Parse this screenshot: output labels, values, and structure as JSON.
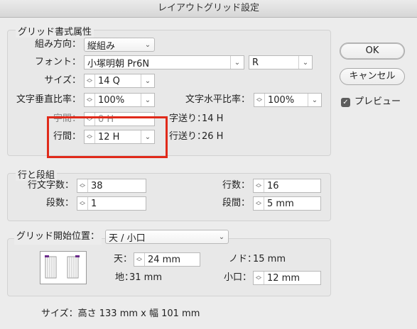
{
  "window": {
    "title": "レイアウトグリッド設定"
  },
  "grid_attributes": {
    "title": "グリッド書式属性",
    "direction": {
      "label": "組み方向：",
      "value": "縦組み"
    },
    "font": {
      "label": "フォント：",
      "family": "小塚明朝 Pr6N",
      "style": "R"
    },
    "size": {
      "label": "サイズ：",
      "value": "14 Q"
    },
    "vertical_scale": {
      "label": "文字垂直比率：",
      "value": "100%"
    },
    "horizontal_scale": {
      "label": "文字水平比率：",
      "value": "100%"
    },
    "char_aki": {
      "label": "字間：",
      "value": "0 H"
    },
    "char_feed": {
      "label": "字送り：",
      "value": "14 H"
    },
    "line_gap": {
      "label": "行間：",
      "value": "12 H"
    },
    "line_feed": {
      "label": "行送り：",
      "value": "26 H"
    }
  },
  "lines_columns": {
    "title": "行と段組",
    "chars_per_line": {
      "label": "行文字数：",
      "value": "38"
    },
    "lines": {
      "label": "行数：",
      "value": "16"
    },
    "columns": {
      "label": "段数：",
      "value": "1"
    },
    "gutter": {
      "label": "段間：",
      "value": "5 mm"
    }
  },
  "grid_start": {
    "label": "グリッド開始位置：",
    "value": "天 / 小口",
    "top": {
      "label": "天：",
      "value": "24 mm"
    },
    "nodo": {
      "label": "ノド：",
      "value": "15 mm"
    },
    "bottom": {
      "label": "地：",
      "value": "31 mm"
    },
    "koguchi": {
      "label": "小口：",
      "value": "12 mm"
    }
  },
  "buttons": {
    "ok": "OK",
    "cancel": "キャンセル",
    "preview": "プレビュー"
  },
  "footer": {
    "size_text": "サイズ：高さ 133 mm x 幅 101 mm"
  },
  "colors": {
    "highlight": "#e02a1a",
    "corner_marker": "#6a2a8a"
  }
}
